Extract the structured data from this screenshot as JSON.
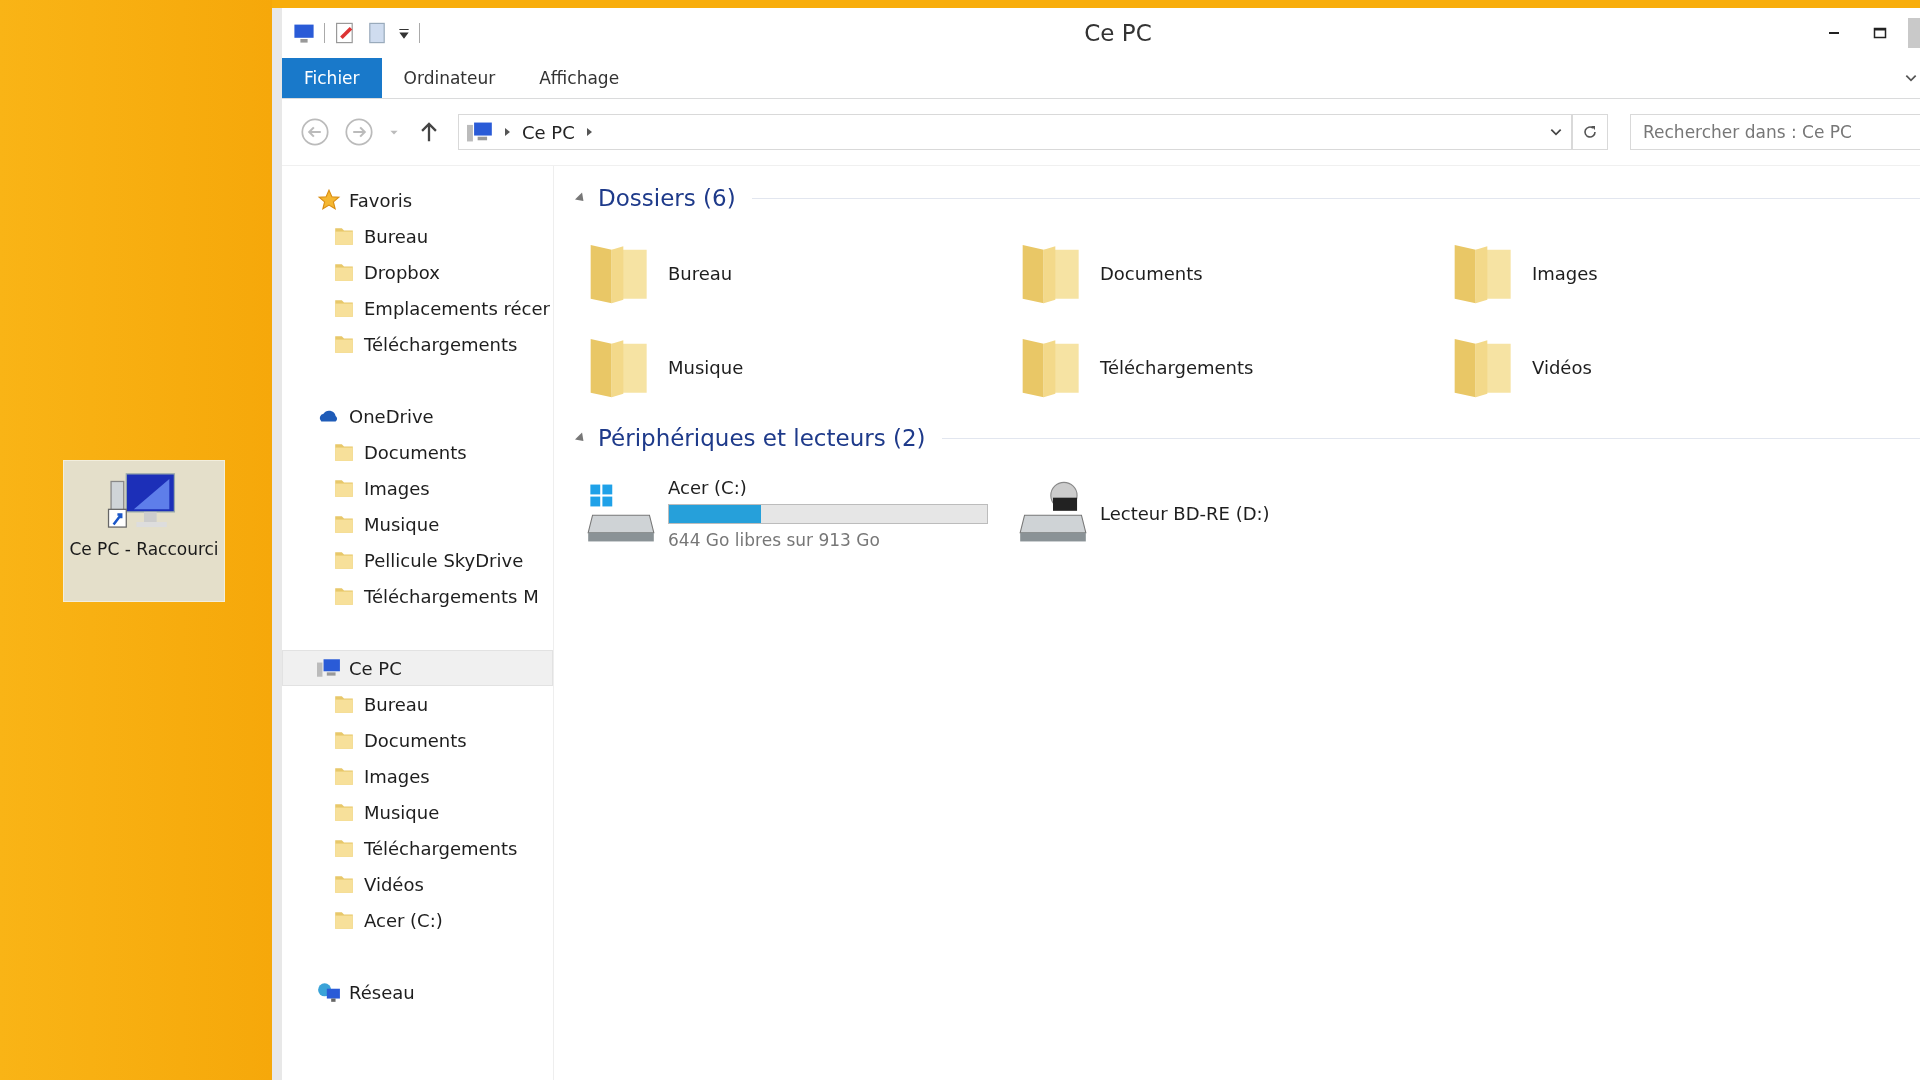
{
  "desktop_icon": {
    "label": "Ce PC - Raccourci",
    "selected": true
  },
  "window": {
    "title": "Ce PC"
  },
  "ribbon_tabs": [
    {
      "label": "Fichier",
      "selected": true
    },
    {
      "label": "Ordinateur",
      "selected": false
    },
    {
      "label": "Affichage",
      "selected": false
    }
  ],
  "address_bar": {
    "path": [
      "Ce PC"
    ]
  },
  "search": {
    "placeholder": "Rechercher dans : Ce PC"
  },
  "sidebar": [
    {
      "label": "Favoris",
      "selected": false,
      "children": [
        {
          "label": "Bureau"
        },
        {
          "label": "Dropbox"
        },
        {
          "label": "Emplacements récer"
        },
        {
          "label": "Téléchargements"
        }
      ]
    },
    {
      "label": "OneDrive",
      "selected": false,
      "children": [
        {
          "label": "Documents"
        },
        {
          "label": "Images"
        },
        {
          "label": "Musique"
        },
        {
          "label": "Pellicule SkyDrive"
        },
        {
          "label": "Téléchargements M"
        }
      ]
    },
    {
      "label": "Ce PC",
      "selected": true,
      "children": [
        {
          "label": "Bureau"
        },
        {
          "label": "Documents"
        },
        {
          "label": "Images"
        },
        {
          "label": "Musique"
        },
        {
          "label": "Téléchargements"
        },
        {
          "label": "Vidéos"
        },
        {
          "label": "Acer (C:)"
        }
      ]
    },
    {
      "label": "Réseau",
      "selected": false
    }
  ],
  "folders_group": {
    "title": "Dossiers (6)",
    "expanded": true,
    "items": [
      {
        "label": "Bureau"
      },
      {
        "label": "Documents"
      },
      {
        "label": "Images"
      },
      {
        "label": "Musique"
      },
      {
        "label": "Téléchargements"
      },
      {
        "label": "Vidéos"
      }
    ]
  },
  "devices_group": {
    "title": "Périphériques et lecteurs (2)",
    "expanded": true,
    "items": [
      {
        "label": "Acer (C:)",
        "kind": "disk",
        "level": 0.29,
        "free": "644 Go libres sur 913 Go"
      },
      {
        "label": "Lecteur BD-RE (D:)",
        "kind": "optical"
      }
    ]
  }
}
